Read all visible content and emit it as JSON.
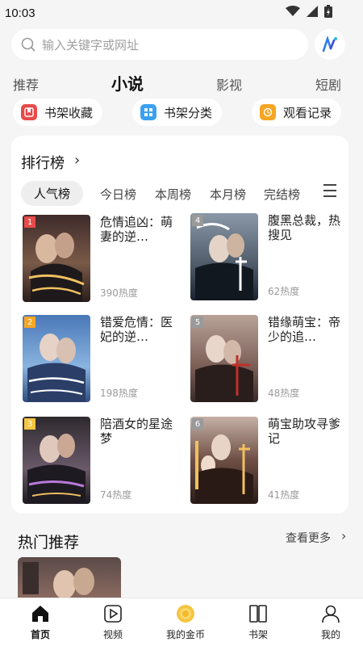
{
  "status": {
    "time": "10:03"
  },
  "search": {
    "placeholder": "输入关键字或网址"
  },
  "tabs": [
    {
      "label": "推荐",
      "active": false
    },
    {
      "label": "小说",
      "active": true
    },
    {
      "label": "影视",
      "active": false
    },
    {
      "label": "短剧",
      "active": false
    }
  ],
  "shortcuts": [
    {
      "label": "书架收藏",
      "icon": "bookshelf-favorite-icon",
      "color": "#e84a4a"
    },
    {
      "label": "书架分类",
      "icon": "category-grid-icon",
      "color": "#3aa0f0"
    },
    {
      "label": "观看记录",
      "icon": "history-clock-icon",
      "color": "#f5a623"
    }
  ],
  "ranking": {
    "title": "排行榜",
    "tabs": [
      "人气榜",
      "今日榜",
      "本周榜",
      "本月榜",
      "完结榜"
    ],
    "active_tab": "人气榜",
    "books": [
      {
        "rank": "1",
        "title": "危情追凶：萌妻的逆…",
        "heat": "390热度",
        "badge_color": "#e84a4a"
      },
      {
        "rank": "2",
        "title": "错爱危情：医妃的逆…",
        "heat": "198热度",
        "badge_color": "#f5a623"
      },
      {
        "rank": "3",
        "title": "陪酒女的星途梦",
        "heat": "74热度",
        "badge_color": "#f5c542"
      },
      {
        "rank": "4",
        "title": "腹黑总裁，热搜见",
        "heat": "62热度",
        "badge_color": "#9a9a9a"
      },
      {
        "rank": "5",
        "title": "错缘萌宝：帝少的追…",
        "heat": "48热度",
        "badge_color": "#9a9a9a"
      },
      {
        "rank": "6",
        "title": "萌宝助攻寻爹记",
        "heat": "41热度",
        "badge_color": "#9a9a9a"
      }
    ]
  },
  "hot": {
    "title": "热门推荐",
    "more": "查看更多"
  },
  "nav": [
    {
      "label": "首页",
      "icon": "home-icon",
      "active": true
    },
    {
      "label": "视频",
      "icon": "video-play-icon",
      "active": false
    },
    {
      "label": "我的金币",
      "icon": "gold-coin-icon",
      "active": false
    },
    {
      "label": "书架",
      "icon": "bookshelf-icon",
      "active": false
    },
    {
      "label": "我的",
      "icon": "profile-icon",
      "active": false
    }
  ]
}
